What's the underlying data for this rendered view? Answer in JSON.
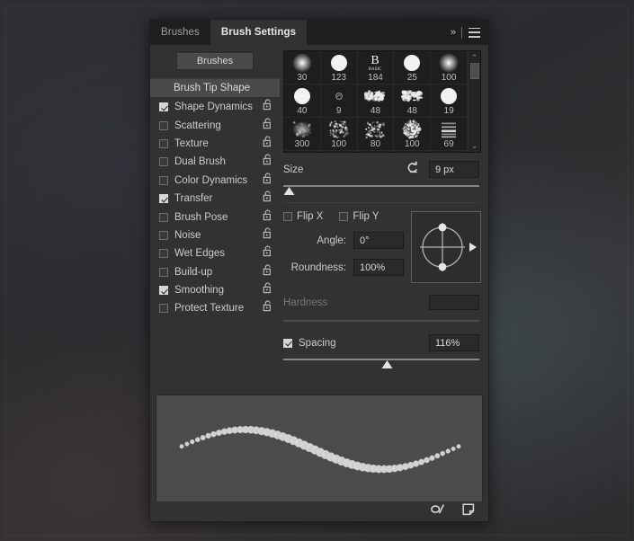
{
  "tabs": [
    {
      "label": "Brushes",
      "active": false
    },
    {
      "label": "Brush Settings",
      "active": true
    }
  ],
  "header": {
    "collapse_label": "»",
    "menu_icon": "hamburger-icon"
  },
  "sidebar": {
    "brushes_button": "Brushes",
    "tip_shape_label": "Brush Tip Shape",
    "items": [
      {
        "label": "Shape Dynamics",
        "checked": true,
        "lock": "unlocked"
      },
      {
        "label": "Scattering",
        "checked": false,
        "lock": "unlocked"
      },
      {
        "label": "Texture",
        "checked": false,
        "lock": "unlocked"
      },
      {
        "label": "Dual Brush",
        "checked": false,
        "lock": "unlocked"
      },
      {
        "label": "Color Dynamics",
        "checked": false,
        "lock": "unlocked"
      },
      {
        "label": "Transfer",
        "checked": true,
        "lock": "unlocked"
      },
      {
        "label": "Brush Pose",
        "checked": false,
        "lock": "unlocked"
      },
      {
        "label": "Noise",
        "checked": false,
        "lock": "unlocked"
      },
      {
        "label": "Wet Edges",
        "checked": false,
        "lock": "unlocked"
      },
      {
        "label": "Build-up",
        "checked": false,
        "lock": "unlocked"
      },
      {
        "label": "Smoothing",
        "checked": true,
        "lock": "unlocked"
      },
      {
        "label": "Protect Texture",
        "checked": false,
        "lock": "unlocked"
      }
    ]
  },
  "brush_grid": {
    "presets": [
      {
        "size": "30",
        "kind": "soft-round"
      },
      {
        "size": "123",
        "kind": "hard-round"
      },
      {
        "size": "184",
        "kind": "letter-b"
      },
      {
        "size": "25",
        "kind": "hard-round"
      },
      {
        "size": "100",
        "kind": "soft-round"
      },
      {
        "size": "40",
        "kind": "hard-round"
      },
      {
        "size": "9",
        "kind": "tiny-swirl"
      },
      {
        "size": "48",
        "kind": "foliage"
      },
      {
        "size": "48",
        "kind": "foliage"
      },
      {
        "size": "19",
        "kind": "hard-round"
      },
      {
        "size": "300",
        "kind": "soft-smudge"
      },
      {
        "size": "100",
        "kind": "speckle"
      },
      {
        "size": "80",
        "kind": "speckle"
      },
      {
        "size": "100",
        "kind": "dense-spatter"
      },
      {
        "size": "69",
        "kind": "stack-lines"
      }
    ],
    "partial_row": [
      {
        "kind": "grain-streak"
      },
      {
        "kind": "streak-blur"
      },
      {
        "kind": "vertical-line"
      },
      {
        "kind": "figure"
      },
      {
        "kind": "faint-text"
      }
    ],
    "scroll_up": "⌃",
    "scroll_down": "⌄"
  },
  "controls": {
    "size": {
      "label": "Size",
      "value": "9 px",
      "slider_percent": 3,
      "reset_icon": "reset-arrow-icon"
    },
    "flip_x": {
      "label": "Flip X",
      "checked": false
    },
    "flip_y": {
      "label": "Flip Y",
      "checked": false
    },
    "angle": {
      "label": "Angle:",
      "value": "0°"
    },
    "roundness": {
      "label": "Roundness:",
      "value": "100%"
    },
    "hardness": {
      "label": "Hardness",
      "value": "",
      "enabled": false
    },
    "spacing": {
      "label": "Spacing",
      "checked": true,
      "value": "116%",
      "slider_percent": 53
    }
  },
  "preview": {
    "name": "brush-stroke-preview",
    "description": "dotted sine-wave stroke"
  },
  "footer": {
    "buttons": [
      {
        "name": "new-brush-preset-icon",
        "title": "Create new brush preset"
      },
      {
        "name": "new-brush-icon",
        "title": "Create new brush"
      }
    ]
  },
  "colors": {
    "panel_bg": "#323232",
    "tab_bar_bg": "#1e1e1e",
    "grid_bg": "#1e1e1e",
    "highlight": "#4a4a4a",
    "text": "#cdcdcd",
    "preview_bg": "#4b4b4b"
  }
}
